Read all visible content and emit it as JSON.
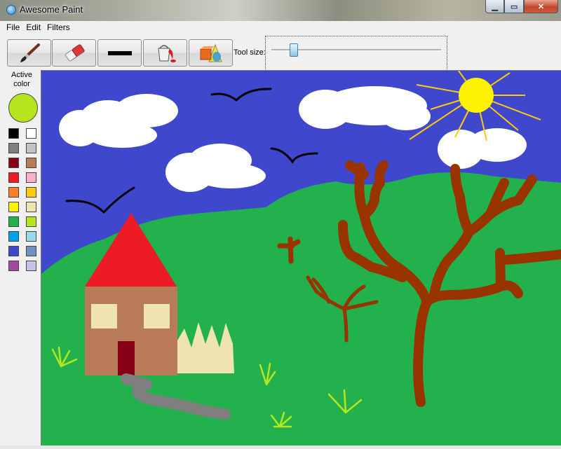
{
  "window": {
    "title": "Awesome Paint"
  },
  "menu": {
    "file": "File",
    "edit": "Edit",
    "filters": "Filters"
  },
  "toolbar": {
    "tools": [
      {
        "name": "brush-tool-button",
        "icon": "paintbrush-icon"
      },
      {
        "name": "eraser-tool-button",
        "icon": "eraser-icon"
      },
      {
        "name": "line-tool-button",
        "icon": "line-icon"
      },
      {
        "name": "fill-tool-button",
        "icon": "paint-bucket-icon"
      },
      {
        "name": "shapes-tool-button",
        "icon": "shapes-icon"
      }
    ],
    "tool_size_label": "Tool size:",
    "tool_size_fraction": 0.13
  },
  "palette": {
    "active_label": "Active\ncolor",
    "active_color": "#b5e61d",
    "swatches": [
      [
        "#000000",
        "#ffffff"
      ],
      [
        "#7f7f7f",
        "#c3c3c3"
      ],
      [
        "#880015",
        "#b97a57"
      ],
      [
        "#ed1c24",
        "#ffaec9"
      ],
      [
        "#ff7f27",
        "#ffc90e"
      ],
      [
        "#fff200",
        "#efe4b0"
      ],
      [
        "#22b14c",
        "#b5e61d"
      ],
      [
        "#00a2e8",
        "#99d9ea"
      ],
      [
        "#3f48cc",
        "#7092be"
      ],
      [
        "#a349a4",
        "#c8bfe7"
      ]
    ]
  },
  "drawing": {
    "sky": "#3f48cc",
    "grass": "#22b14c",
    "cloud": "#ffffff",
    "sun": "#fff200",
    "sun_rays": "#ffc90e",
    "roof": "#ed1c24",
    "house_wall": "#b97a57",
    "window": "#efe4b0",
    "door": "#880015",
    "fence": "#efe4b0",
    "path": "#7f7f7f",
    "tree": "#993300",
    "birds": "#000000",
    "grass_tufts": "#b5e61d"
  }
}
